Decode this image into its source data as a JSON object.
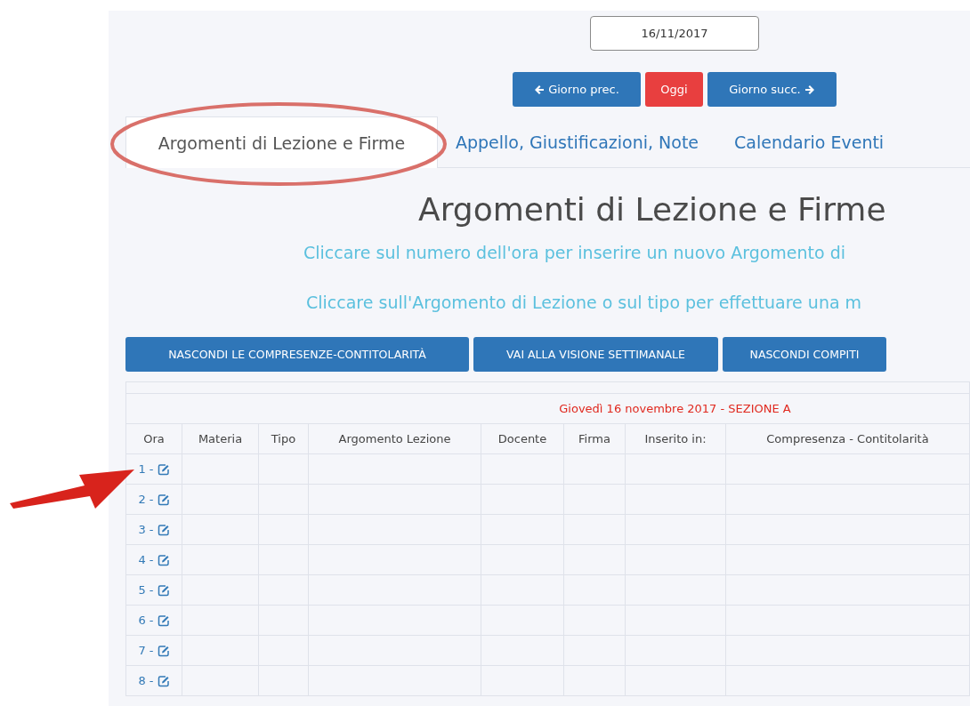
{
  "date_field": {
    "value": "16/11/2017"
  },
  "day_nav": [
    {
      "label": "Giorno prec.",
      "kind": "prev"
    },
    {
      "label": "Oggi",
      "kind": "today"
    },
    {
      "label": "Giorno succ.",
      "kind": "next"
    }
  ],
  "tabs": [
    {
      "label": "Argomenti di Lezione e Firme",
      "selected": true
    },
    {
      "label": "Appello, Giustificazioni, Note",
      "selected": false
    },
    {
      "label": "Calendario Eventi",
      "selected": false
    }
  ],
  "heading": "Argomenti di Lezione e Firme",
  "instructions": [
    "Cliccare sul numero dell'ora per inserire un nuovo Argomento di",
    "Cliccare sull'Argomento di Lezione o sul tipo per effettuare una m"
  ],
  "actions": [
    "NASCONDI LE COMPRESENZE-CONTITOLARITÀ",
    "VAI ALLA VISIONE SETTIMANALE",
    "NASCONDI COMPITI"
  ],
  "table": {
    "caption": "Giovedì 16 novembre 2017 - SEZIONE A",
    "columns": [
      "Ora",
      "Materia",
      "Tipo",
      "Argomento Lezione",
      "Docente",
      "Firma",
      "Inserito in:",
      "Compresenza - Contitolarità"
    ],
    "rows": [
      {
        "ora": "1 -"
      },
      {
        "ora": "2 -"
      },
      {
        "ora": "3 -"
      },
      {
        "ora": "4 -"
      },
      {
        "ora": "5 -"
      },
      {
        "ora": "6 -"
      },
      {
        "ora": "7 -"
      },
      {
        "ora": "8 -"
      }
    ]
  }
}
